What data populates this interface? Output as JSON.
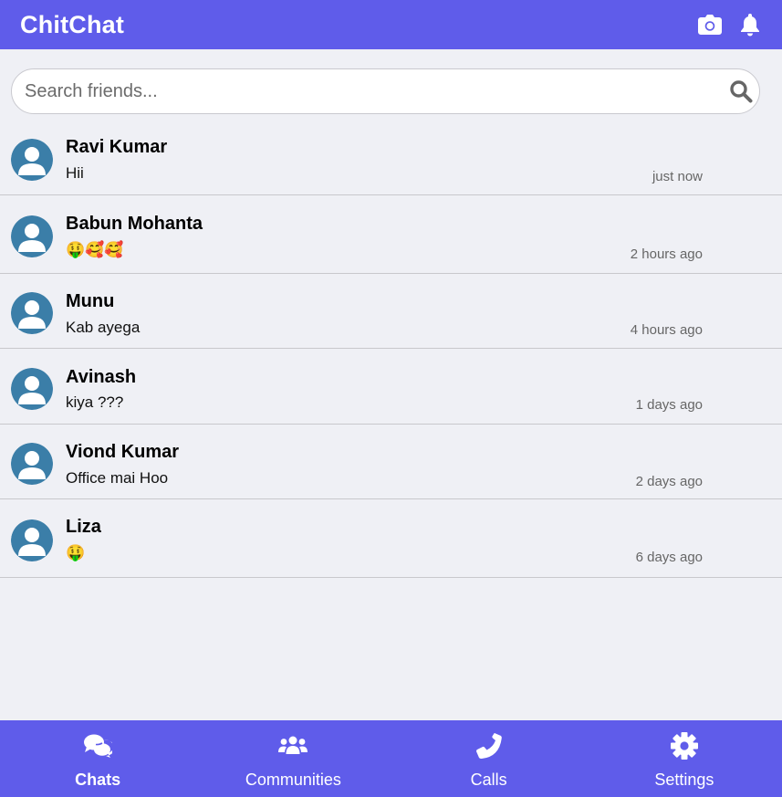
{
  "header": {
    "title": "ChitChat",
    "icons": [
      "camera-icon",
      "bell-icon"
    ]
  },
  "search": {
    "placeholder": "Search friends...",
    "value": ""
  },
  "chats": [
    {
      "name": "Ravi Kumar",
      "message": "Hii",
      "time": "just now"
    },
    {
      "name": "Babun Mohanta",
      "message": "🤑🥰🥰",
      "time": "2 hours ago"
    },
    {
      "name": "Munu",
      "message": "Kab ayega",
      "time": "4 hours ago"
    },
    {
      "name": "Avinash",
      "message": "kiya ???",
      "time": "1 days ago"
    },
    {
      "name": "Viond Kumar",
      "message": "Office mai Hoo",
      "time": "2 days ago"
    },
    {
      "name": "Liza",
      "message": "🤑",
      "time": "6 days ago"
    }
  ],
  "nav": [
    {
      "label": "Chats",
      "icon": "chat-bubbles-icon",
      "active": true
    },
    {
      "label": "Communities",
      "icon": "users-icon",
      "active": false
    },
    {
      "label": "Calls",
      "icon": "phone-icon",
      "active": false
    },
    {
      "label": "Settings",
      "icon": "gear-icon",
      "active": false
    }
  ],
  "colors": {
    "accent": "#5f5cea",
    "background": "#eff0f5",
    "avatar": "#3b7ea8"
  }
}
